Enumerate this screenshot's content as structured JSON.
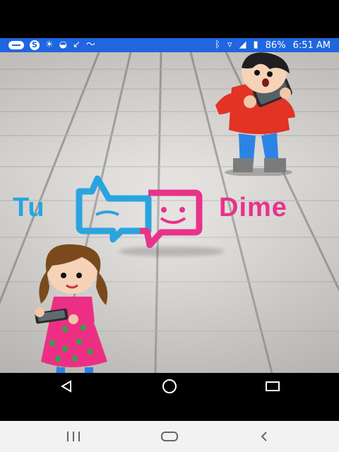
{
  "status_bar": {
    "battery": "86%",
    "time": "6:51 AM",
    "icons_left": [
      "chat-icon",
      "skype-icon",
      "brightness-icon",
      "speedometer-icon",
      "missed-call-icon",
      "trend-icon"
    ],
    "icons_right": [
      "bluetooth-icon",
      "wifi-icon",
      "signal-icon",
      "battery-icon"
    ]
  },
  "app": {
    "logo": {
      "left_word": "Tu",
      "right_word": "Dime",
      "left_color": "#2aa4df",
      "right_color": "#e8338b"
    }
  },
  "colors": {
    "status_bar_bg": "#1f66e0",
    "floor_light": "#e7e5e2",
    "floor_line": "#8f8d8b"
  },
  "nav": {
    "device_icons": [
      "back-icon",
      "home-icon",
      "recents-icon"
    ],
    "system_icons": [
      "recent-apps-icon",
      "home-pill-icon",
      "back-chevron-icon"
    ]
  }
}
